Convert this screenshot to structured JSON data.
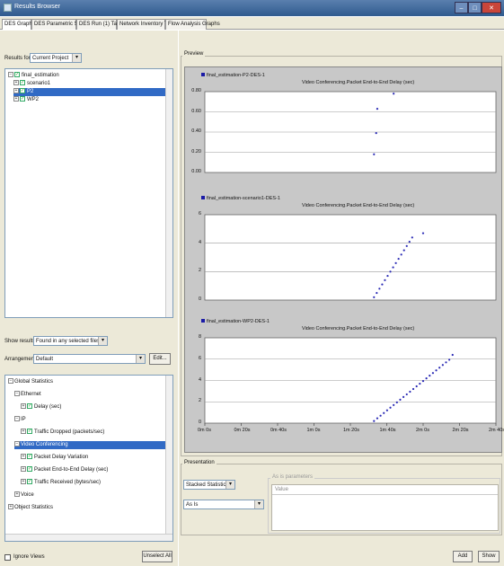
{
  "window": {
    "title": "Results Browser",
    "controls": {
      "min": "–",
      "max": "□",
      "close": "✕"
    }
  },
  "tabs": [
    {
      "label": "DES Graphs",
      "active": true
    },
    {
      "label": "DES Parametric Studies",
      "active": false
    },
    {
      "label": "DES Run (1) Tables",
      "active": false
    },
    {
      "label": "Network Inventory Tables",
      "active": false
    },
    {
      "label": "Flow Analysis Graphs",
      "active": false
    }
  ],
  "results_for": {
    "label": "Results for:",
    "value": "Current Project"
  },
  "project_tree": {
    "root": "final_estimation",
    "items": [
      "scenario1",
      "P2",
      "WP2"
    ],
    "selected_index": 1
  },
  "show_results": {
    "label": "Show results:",
    "value": "Found in any selected files"
  },
  "arrangement": {
    "label": "Arrangement:",
    "value": "Default",
    "edit_label": "Edit..."
  },
  "stats_tree": {
    "rows": [
      {
        "exp": "⊟",
        "label": "Global Statistics",
        "indent": 0,
        "chk": false,
        "sel": false
      },
      {
        "exp": "⊟",
        "label": "Ethernet",
        "indent": 1,
        "chk": false,
        "sel": false
      },
      {
        "exp": "⊞",
        "label": "Delay (sec)",
        "indent": 2,
        "chk": true,
        "sel": false
      },
      {
        "exp": "⊟",
        "label": "IP",
        "indent": 1,
        "chk": false,
        "sel": false
      },
      {
        "exp": "⊞",
        "label": "Traffic Dropped (packets/sec)",
        "indent": 2,
        "chk": true,
        "sel": false
      },
      {
        "exp": "⊟",
        "label": "Video Conferencing",
        "indent": 1,
        "chk": false,
        "sel": true
      },
      {
        "exp": "⊞",
        "label": "Packet Delay Variation",
        "indent": 2,
        "chk": true,
        "sel": false
      },
      {
        "exp": "⊞",
        "label": "Packet End-to-End Delay (sec)",
        "indent": 2,
        "chk": true,
        "sel": false
      },
      {
        "exp": "⊞",
        "label": "Traffic Received (bytes/sec)",
        "indent": 2,
        "chk": true,
        "sel": false
      },
      {
        "exp": "⊞",
        "label": "Voice",
        "indent": 1,
        "chk": false,
        "sel": false
      },
      {
        "exp": "⊞",
        "label": "Object Statistics",
        "indent": 0,
        "chk": false,
        "sel": false
      }
    ]
  },
  "ignore_views": {
    "label": "Ignore Views"
  },
  "unselect_all": {
    "label": "Unselect All"
  },
  "preview": {
    "label": "Preview"
  },
  "presentation": {
    "label": "Presentation",
    "mode": "Stacked Statistics",
    "filter": "As Is",
    "param_label": "As is parameters",
    "value_header": "Value"
  },
  "buttons": {
    "add": "Add",
    "show": "Show"
  },
  "chart_data": [
    {
      "type": "scatter",
      "legend": "final_estimation-P2-DES-1",
      "title": "Video Conferencing.Packet End-to-End Delay (sec)",
      "yticks": [
        "0.00",
        "0.20",
        "0.40",
        "0.60",
        "0.80"
      ],
      "ylim": [
        0,
        0.8
      ],
      "x": [
        1.55,
        1.57,
        1.58,
        1.73
      ],
      "y": [
        0.18,
        0.39,
        0.63,
        0.78
      ],
      "grid": true
    },
    {
      "type": "scatter",
      "legend": "final_estimation-scenario1-DES-1",
      "title": "Video Conferencing.Packet End-to-End Delay (sec)",
      "yticks": [
        "0",
        "2",
        "4",
        "6"
      ],
      "ylim": [
        0,
        6
      ],
      "x": [
        1.55,
        1.575,
        1.6,
        1.625,
        1.65,
        1.675,
        1.7,
        1.725,
        1.75,
        1.775,
        1.8,
        1.825,
        1.85,
        1.875,
        1.9,
        2.0
      ],
      "y": [
        0.2,
        0.5,
        0.8,
        1.1,
        1.4,
        1.7,
        2.0,
        2.3,
        2.6,
        2.9,
        3.2,
        3.5,
        3.8,
        4.1,
        4.4,
        4.7
      ],
      "grid": true
    },
    {
      "type": "scatter",
      "legend": "final_estimation-WP2-DES-1",
      "title": "Video Conferencing.Packet End-to-End Delay (sec)",
      "yticks": [
        "0",
        "2",
        "4",
        "6",
        "8"
      ],
      "ylim": [
        0,
        8
      ],
      "xticks": [
        "0m 0s",
        "0m 20s",
        "0m 40s",
        "1m 0s",
        "1m 20s",
        "1m 40s",
        "2m 0s",
        "2m 20s",
        "2m 40s"
      ],
      "xlim": [
        0,
        2.667
      ],
      "x": [
        1.55,
        1.58,
        1.61,
        1.64,
        1.67,
        1.7,
        1.73,
        1.76,
        1.79,
        1.82,
        1.85,
        1.88,
        1.91,
        1.94,
        1.97,
        2.0,
        2.03,
        2.06,
        2.09,
        2.12,
        2.15,
        2.18,
        2.21,
        2.24,
        2.27
      ],
      "y": [
        0.2,
        0.45,
        0.7,
        0.95,
        1.2,
        1.45,
        1.7,
        1.95,
        2.2,
        2.45,
        2.7,
        2.95,
        3.2,
        3.45,
        3.7,
        3.95,
        4.2,
        4.45,
        4.7,
        4.95,
        5.2,
        5.45,
        5.7,
        5.95,
        6.4
      ],
      "grid": true
    }
  ]
}
